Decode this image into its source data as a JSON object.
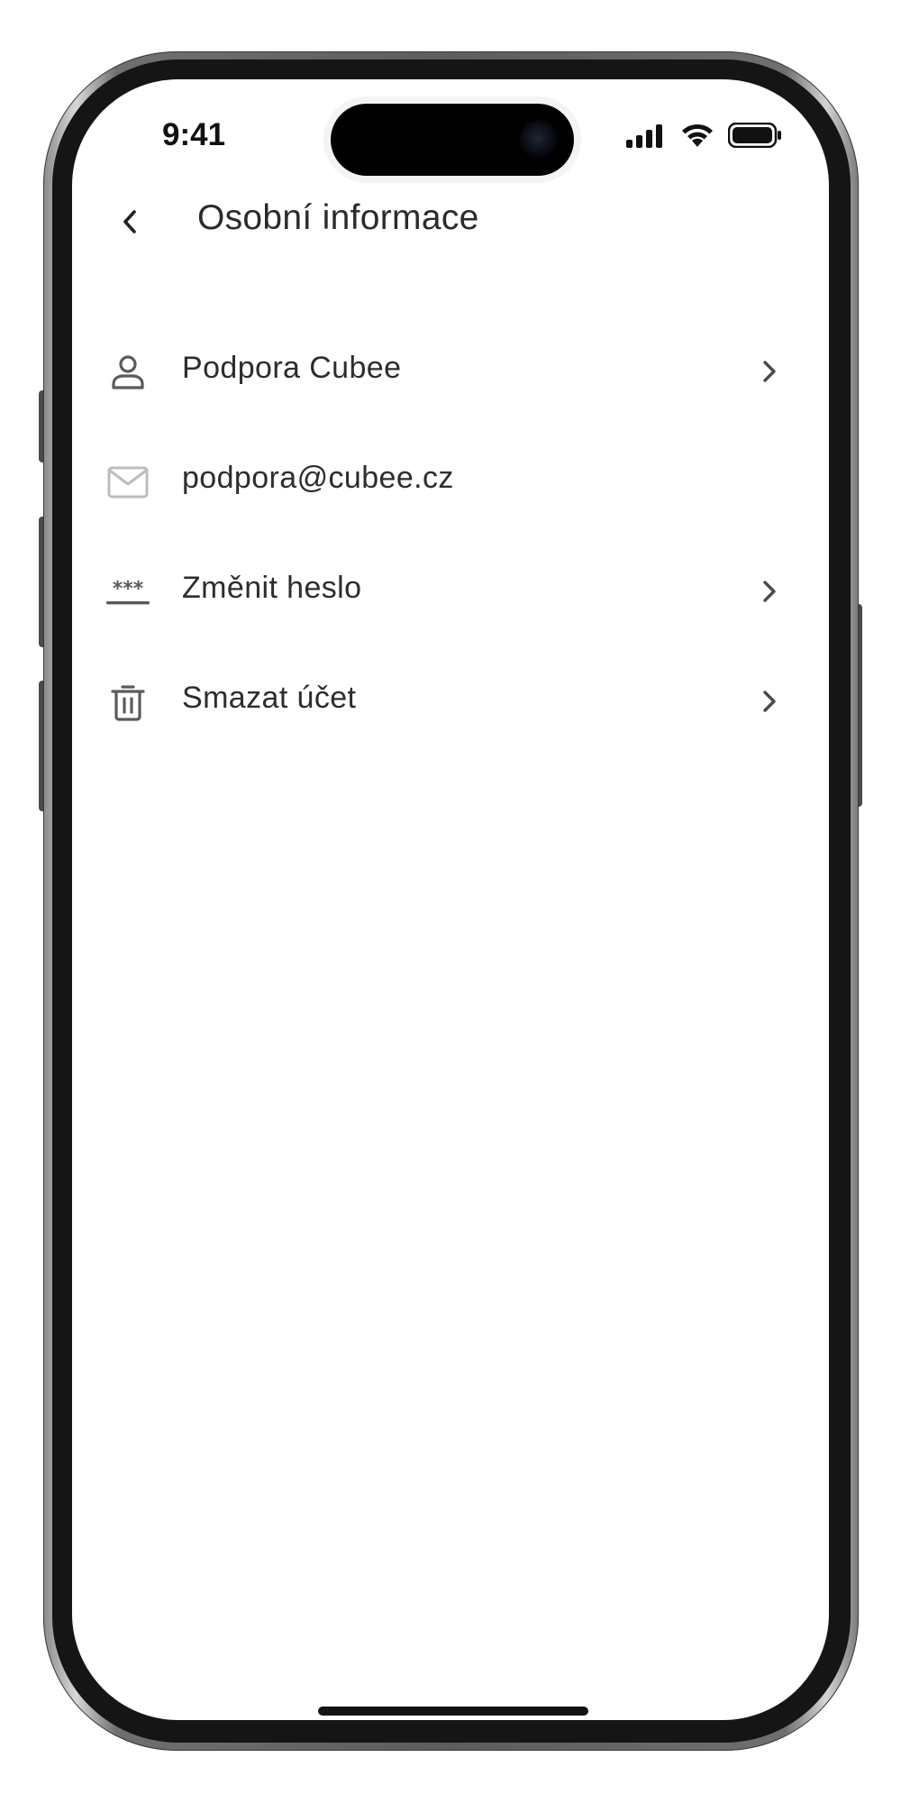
{
  "status_bar": {
    "time": "9:41",
    "icons": [
      "cellular-signal-icon",
      "wifi-icon",
      "battery-icon"
    ]
  },
  "header": {
    "back_icon": "chevron-left-icon",
    "title": "Osobní informace"
  },
  "list": {
    "items": [
      {
        "id": "profile",
        "icon": "user-icon",
        "label": "Podpora Cubee",
        "has_chevron": true
      },
      {
        "id": "email",
        "icon": "mail-icon",
        "label": "podpora@cubee.cz",
        "has_chevron": false
      },
      {
        "id": "password",
        "icon": "password-icon",
        "label": "Změnit heslo",
        "has_chevron": true
      },
      {
        "id": "delete",
        "icon": "trash-icon",
        "label": "Smazat účet",
        "has_chevron": true
      }
    ]
  },
  "colors": {
    "text": "#2d2d2d",
    "icon": "#5a5a5a",
    "icon_muted": "#bdbdbd",
    "screen_background": "#ffffff",
    "frame": "#151515"
  }
}
